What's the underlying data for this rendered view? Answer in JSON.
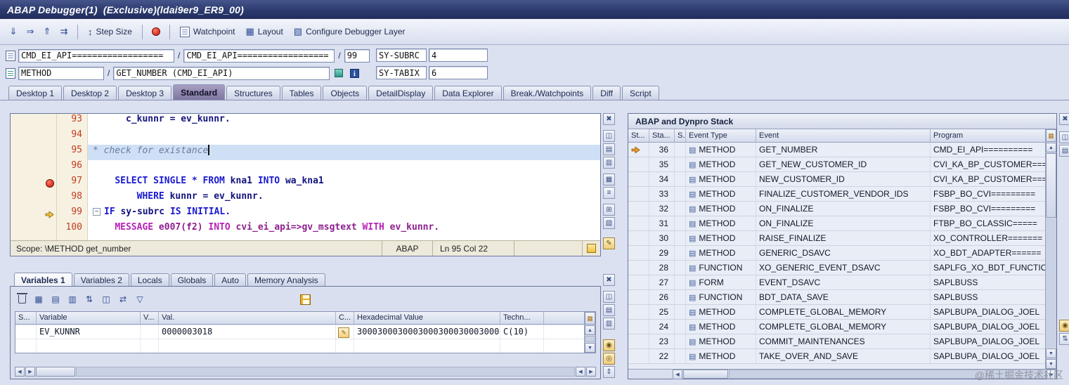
{
  "titlebar": {
    "title": "ABAP Debugger(1)  (Exclusive)(ldai9er9_ER9_00)"
  },
  "glyphs": {
    "up": "▲",
    "down": "▼",
    "left": "◀",
    "right": "▶",
    "grid": "▦",
    "doc": "▤",
    "pencil": "✎"
  },
  "toolbar": {
    "step_icons": [
      {
        "name": "step-into-button",
        "glyph": "⇓"
      },
      {
        "name": "step-over-button",
        "glyph": "⇒"
      },
      {
        "name": "step-out-button",
        "glyph": "⇑"
      },
      {
        "name": "continue-button",
        "glyph": "⇉"
      }
    ],
    "step_size_icon_glyph": "↕",
    "step_size_label": "Step Size",
    "watchpoint_label": "Watchpoint",
    "layout_icon_glyph": "▦",
    "layout_label": "Layout",
    "configure_icon_glyph": "▧",
    "configure_label": "Configure Debugger Layer"
  },
  "context": {
    "sep": "/",
    "row1": {
      "program": "CMD_EI_API==================",
      "include": "CMD_EI_API==================",
      "line": "99",
      "sys_label": "SY-SUBRC",
      "sys_value": "4"
    },
    "row2": {
      "event_type": "METHOD",
      "event": "GET_NUMBER (CMD_EI_API)",
      "info_glyph": "i",
      "sys_label": "SY-TABIX",
      "sys_value": "6"
    }
  },
  "tabs": [
    {
      "label": "Desktop 1"
    },
    {
      "label": "Desktop 2"
    },
    {
      "label": "Desktop 3"
    },
    {
      "label": "Standard",
      "active": true
    },
    {
      "label": "Structures"
    },
    {
      "label": "Tables"
    },
    {
      "label": "Objects"
    },
    {
      "label": "DetailDisplay"
    },
    {
      "label": "Data Explorer"
    },
    {
      "label": "Break./Watchpoints"
    },
    {
      "label": "Diff"
    },
    {
      "label": "Script"
    }
  ],
  "editor": {
    "lines": [
      {
        "num": "93",
        "segs": [
          [
            "p",
            "      "
          ],
          [
            "i",
            "c_kunnr = ev_kunnr."
          ]
        ]
      },
      {
        "num": "94",
        "segs": []
      },
      {
        "num": "95",
        "current": true,
        "cursor": true,
        "segs": [
          [
            "c",
            "* check for existance"
          ]
        ]
      },
      {
        "num": "96",
        "segs": []
      },
      {
        "num": "97",
        "breakpoint": true,
        "segs": [
          [
            "p",
            "    "
          ],
          [
            "k",
            "SELECT SINGLE * FROM"
          ],
          [
            "i",
            " kna1 "
          ],
          [
            "k",
            "INTO"
          ],
          [
            "i",
            " wa_kna1"
          ]
        ]
      },
      {
        "num": "98",
        "segs": [
          [
            "p",
            "        "
          ],
          [
            "k",
            "WHERE"
          ],
          [
            "i",
            " kunnr = ev_kunnr."
          ]
        ]
      },
      {
        "num": "99",
        "arrow": true,
        "fold": true,
        "segs": [
          [
            "k",
            "IF"
          ],
          [
            "i",
            " sy-subrc "
          ],
          [
            "k",
            "IS INITIAL."
          ]
        ]
      },
      {
        "num": "100",
        "segs": [
          [
            "p",
            "    "
          ],
          [
            "m",
            "MESSAGE"
          ],
          [
            "n",
            " e007(f2) "
          ],
          [
            "m",
            "INTO"
          ],
          [
            "n",
            " cvi_ei_api=>gv_msgtext "
          ],
          [
            "m",
            "WITH"
          ],
          [
            "n",
            " ev_kunnr."
          ]
        ]
      },
      {
        "num": "",
        "segs": []
      }
    ],
    "status": {
      "scope": "Scope: \\METHOD get_number",
      "lang": "ABAP",
      "position": "Ln 95 Col 22"
    }
  },
  "variables": {
    "tabs": [
      {
        "label": "Variables 1",
        "active": true
      },
      {
        "label": "Variables 2"
      },
      {
        "label": "Locals"
      },
      {
        "label": "Globals"
      },
      {
        "label": "Auto"
      },
      {
        "label": "Memory Analysis"
      }
    ],
    "toolbar_icons": [
      {
        "name": "delete-button",
        "icon": "trash"
      },
      {
        "name": "table-view-button",
        "glyph": "▦"
      },
      {
        "name": "detail-view-button",
        "glyph": "▤"
      },
      {
        "name": "export-button",
        "glyph": "▥"
      },
      {
        "name": "sort-button",
        "glyph": "⇅"
      },
      {
        "name": "compare-button",
        "glyph": "◫"
      },
      {
        "name": "swap-button",
        "glyph": "⇄"
      },
      {
        "name": "filter-button",
        "glyph": "▽"
      }
    ],
    "columns": [
      "S...",
      "Variable",
      "V...",
      "Val.",
      "C...",
      "Hexadecimal Value",
      "Techn..."
    ],
    "rows": [
      {
        "variable": "EV_KUNNR",
        "v": "",
        "val": "0000003018",
        "has_edit": true,
        "hex": "3000300030003000300030003000...",
        "tech": "C(10)"
      },
      {
        "variable": "",
        "v": "",
        "val": "",
        "has_edit": false,
        "hex": "",
        "tech": ""
      }
    ]
  },
  "stack": {
    "title": "ABAP and Dynpro Stack",
    "columns": [
      "St...",
      "Sta...",
      "S..",
      "Event Type",
      "Event",
      "Program"
    ],
    "rows": [
      {
        "active": true,
        "num": "36",
        "type": "METHOD",
        "event": "GET_NUMBER",
        "program": "CMD_EI_API=========="
      },
      {
        "num": "35",
        "type": "METHOD",
        "event": "GET_NEW_CUSTOMER_ID",
        "program": "CVI_KA_BP_CUSTOMER==="
      },
      {
        "num": "34",
        "type": "METHOD",
        "event": "NEW_CUSTOMER_ID",
        "program": "CVI_KA_BP_CUSTOMER==="
      },
      {
        "num": "33",
        "type": "METHOD",
        "event": "FINALIZE_CUSTOMER_VENDOR_IDS",
        "program": "FSBP_BO_CVI========="
      },
      {
        "num": "32",
        "type": "METHOD",
        "event": "ON_FINALIZE",
        "program": "FSBP_BO_CVI========="
      },
      {
        "num": "31",
        "type": "METHOD",
        "event": "ON_FINALIZE",
        "program": "FTBP_BO_CLASSIC====="
      },
      {
        "num": "30",
        "type": "METHOD",
        "event": "RAISE_FINALIZE",
        "program": "XO_CONTROLLER======="
      },
      {
        "num": "29",
        "type": "METHOD",
        "event": "GENERIC_DSAVC",
        "program": "XO_BDT_ADAPTER======"
      },
      {
        "num": "28",
        "type": "FUNCTION",
        "event": "XO_GENERIC_EVENT_DSAVC",
        "program": "SAPLFG_XO_BDT_FUNCTION"
      },
      {
        "num": "27",
        "type": "FORM",
        "event": "EVENT_DSAVC",
        "program": "SAPLBUSS"
      },
      {
        "num": "26",
        "type": "FUNCTION",
        "event": "BDT_DATA_SAVE",
        "program": "SAPLBUSS"
      },
      {
        "num": "25",
        "type": "METHOD",
        "event": "COMPLETE_GLOBAL_MEMORY",
        "program": "SAPLBUPA_DIALOG_JOEL"
      },
      {
        "num": "24",
        "type": "METHOD",
        "event": "COMPLETE_GLOBAL_MEMORY",
        "program": "SAPLBUPA_DIALOG_JOEL"
      },
      {
        "num": "23",
        "type": "METHOD",
        "event": "COMMIT_MAINTENANCES",
        "program": "SAPLBUPA_DIALOG_JOEL"
      },
      {
        "num": "22",
        "type": "METHOD",
        "event": "TAKE_OVER_AND_SAVE",
        "program": "SAPLBUPA_DIALOG_JOEL"
      }
    ]
  },
  "side_buttons": {
    "editor": [
      {
        "name": "close-button",
        "glyph": "✖"
      },
      {
        "spacer": 3
      },
      {
        "name": "split-view-button",
        "glyph": "◫"
      },
      {
        "name": "rows-button",
        "glyph": "▤"
      },
      {
        "name": "columns-button",
        "glyph": "▥"
      },
      {
        "spacer": 3
      },
      {
        "name": "grid-button",
        "glyph": "▦"
      },
      {
        "name": "list-button",
        "glyph": "≡"
      },
      {
        "spacer": 3
      },
      {
        "name": "add-button",
        "glyph": "⊞"
      },
      {
        "name": "pattern-button",
        "glyph": "▧"
      },
      {
        "spacer": 8
      },
      {
        "name": "notes-button",
        "glyph": "✎",
        "gold": true
      }
    ],
    "variables": [
      {
        "name": "close-button",
        "glyph": "✖"
      },
      {
        "spacer": 3
      },
      {
        "name": "split-view-button",
        "glyph": "◫"
      },
      {
        "name": "rows-button",
        "glyph": "▤"
      },
      {
        "name": "columns-button",
        "glyph": "▥"
      },
      {
        "spacer": 10
      },
      {
        "name": "lock-button",
        "glyph": "◉",
        "gold": true
      },
      {
        "name": "key-button",
        "glyph": "◎",
        "gold": true
      },
      {
        "name": "resize-button",
        "glyph": "⇕"
      }
    ],
    "window": [
      {
        "name": "close-button",
        "glyph": "✖"
      },
      {
        "spacer": 5
      },
      {
        "name": "split-view-button",
        "glyph": "◫"
      },
      {
        "name": "rows-button",
        "glyph": "▤"
      },
      {
        "spacer": 228
      },
      {
        "name": "lock-button",
        "glyph": "◉",
        "gold": true
      },
      {
        "name": "refresh-button",
        "glyph": "⇅"
      }
    ]
  },
  "watermark": "@稀土掘金技术社区"
}
